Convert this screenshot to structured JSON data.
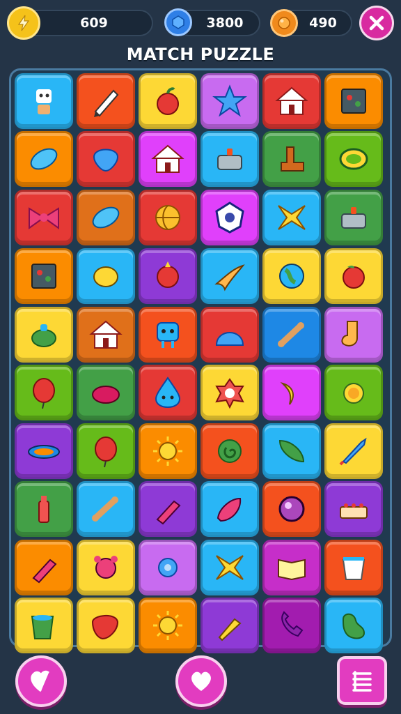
{
  "hud": {
    "coins": {
      "value": "609",
      "icon": "lightning-coin-icon",
      "color": "#f5c21a"
    },
    "gems": {
      "value": "3800",
      "icon": "blue-gem-icon",
      "color": "#2f7fe6"
    },
    "orbs": {
      "value": "490",
      "icon": "orange-orb-icon",
      "color": "#f08a1c"
    },
    "close_icon": "close-icon"
  },
  "title": "MATCH PUZZLE",
  "board": {
    "rows": [
      [
        {
          "color": "#29b6f6",
          "icon": "robot-icon"
        },
        {
          "color": "#f4511e",
          "icon": "pencil-icon"
        },
        {
          "color": "#fdd835",
          "icon": "apple-icon"
        },
        {
          "color": "#c86bf0",
          "icon": "star-icon"
        },
        {
          "color": "#e53935",
          "icon": "house-icon"
        },
        {
          "color": "#fb8c00",
          "icon": "picture-frame-icon"
        }
      ],
      [
        {
          "color": "#fb8c00",
          "icon": "planet-icon"
        },
        {
          "color": "#e53935",
          "icon": "blob-icon"
        },
        {
          "color": "#e040fb",
          "icon": "house-icon"
        },
        {
          "color": "#29b6f6",
          "icon": "pot-icon"
        },
        {
          "color": "#43a047",
          "icon": "boot-icon"
        },
        {
          "color": "#66bb1a",
          "icon": "ring-icon"
        }
      ],
      [
        {
          "color": "#e53935",
          "icon": "bow-icon"
        },
        {
          "color": "#e0701a",
          "icon": "planet-icon"
        },
        {
          "color": "#e53935",
          "icon": "ball-icon"
        },
        {
          "color": "#e040fb",
          "icon": "shield-icon"
        },
        {
          "color": "#29b6f6",
          "icon": "x-star-icon"
        },
        {
          "color": "#43a047",
          "icon": "pot-icon"
        }
      ],
      [
        {
          "color": "#fb8c00",
          "icon": "picture-frame-icon"
        },
        {
          "color": "#29b6f6",
          "icon": "lemon-icon"
        },
        {
          "color": "#8e3ad6",
          "icon": "sun-fruit-icon"
        },
        {
          "color": "#29b6f6",
          "icon": "boomerang-icon"
        },
        {
          "color": "#fdd835",
          "icon": "globe-icon"
        },
        {
          "color": "#fdd835",
          "icon": "peach-icon"
        }
      ],
      [
        {
          "color": "#fdd835",
          "icon": "teapot-icon"
        },
        {
          "color": "#e0701a",
          "icon": "house-icon"
        },
        {
          "color": "#f4511e",
          "icon": "robot-face-icon"
        },
        {
          "color": "#e53935",
          "icon": "dome-icon"
        },
        {
          "color": "#1e88e5",
          "icon": "bone-icon"
        },
        {
          "color": "#c86bf0",
          "icon": "sock-icon"
        }
      ],
      [
        {
          "color": "#66bb1a",
          "icon": "balloon-icon"
        },
        {
          "color": "#43a047",
          "icon": "plum-icon"
        },
        {
          "color": "#e53935",
          "icon": "drop-face-icon"
        },
        {
          "color": "#fdd835",
          "icon": "flower-icon"
        },
        {
          "color": "#e040fb",
          "icon": "banana-icon"
        },
        {
          "color": "#66bb1a",
          "icon": "turtle-icon"
        }
      ],
      [
        {
          "color": "#8e3ad6",
          "icon": "saturn-icon"
        },
        {
          "color": "#66bb1a",
          "icon": "balloon-icon"
        },
        {
          "color": "#fb8c00",
          "icon": "sun-icon"
        },
        {
          "color": "#f4511e",
          "icon": "swirl-icon"
        },
        {
          "color": "#29b6f6",
          "icon": "leaf-icon"
        },
        {
          "color": "#fdd835",
          "icon": "rocket-icon"
        }
      ],
      [
        {
          "color": "#43a047",
          "icon": "bottle-icon"
        },
        {
          "color": "#29b6f6",
          "icon": "bone-icon"
        },
        {
          "color": "#8e3ad6",
          "icon": "crayon-icon"
        },
        {
          "color": "#29b6f6",
          "icon": "eggplant-icon"
        },
        {
          "color": "#f4511e",
          "icon": "orb-icon"
        },
        {
          "color": "#8e3ad6",
          "icon": "cake-icon"
        }
      ],
      [
        {
          "color": "#fb8c00",
          "icon": "crayon-icon"
        },
        {
          "color": "#fdd835",
          "icon": "bear-icon"
        },
        {
          "color": "#c86bf0",
          "icon": "gear-icon"
        },
        {
          "color": "#29b6f6",
          "icon": "x-star-icon"
        },
        {
          "color": "#c62ec9",
          "icon": "book-icon"
        },
        {
          "color": "#f4511e",
          "icon": "cup-icon"
        }
      ],
      [
        {
          "color": "#fdd835",
          "icon": "mug-icon"
        },
        {
          "color": "#fdd835",
          "icon": "strawberry-icon"
        },
        {
          "color": "#fb8c00",
          "icon": "sun-icon"
        },
        {
          "color": "#8e3ad6",
          "icon": "carrot-icon"
        },
        {
          "color": "#a21caf",
          "icon": "phone-icon"
        },
        {
          "color": "#29b6f6",
          "icon": "bean-icon"
        }
      ]
    ]
  },
  "footer": {
    "left_icon": "leaf-heart-icon",
    "center_icon": "heart-icon",
    "right_icon": "menu-icon"
  }
}
